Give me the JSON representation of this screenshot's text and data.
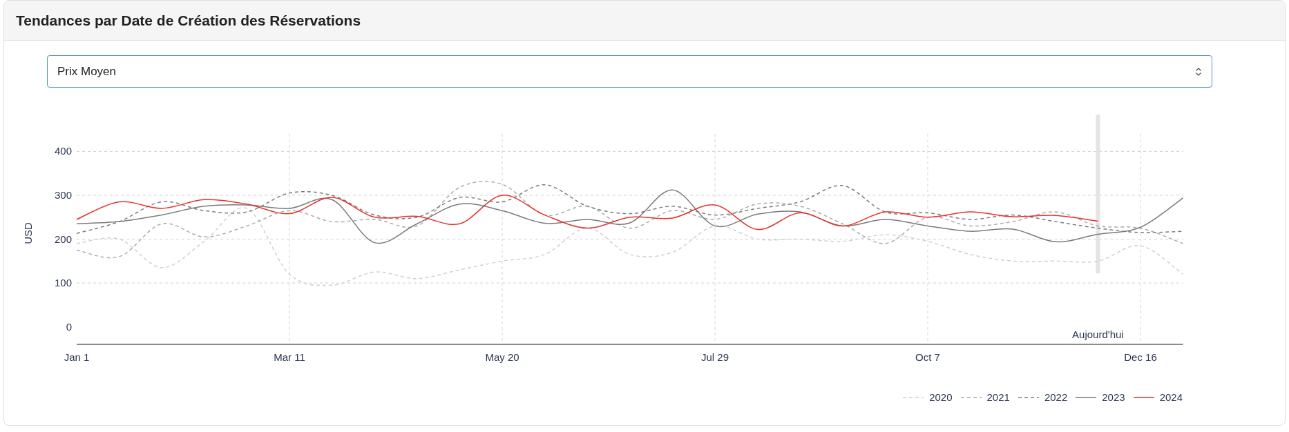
{
  "panel": {
    "title": "Tendances par Date de Création des Réservations"
  },
  "metric_select": {
    "value": "Prix Moyen"
  },
  "chart_data": {
    "type": "line",
    "ylabel": "USD",
    "grid": true,
    "ylim": [
      -40,
      440
    ],
    "categories": [
      "Jan 1",
      null,
      null,
      null,
      null,
      "Mar 11",
      null,
      null,
      null,
      null,
      "May 20",
      null,
      null,
      null,
      null,
      "Jul 29",
      null,
      null,
      null,
      null,
      "Oct 7",
      null,
      null,
      null,
      null,
      "Dec 16",
      null
    ],
    "yticks": [
      0,
      100,
      200,
      300,
      400
    ],
    "series": [
      {
        "name": "2020",
        "color": "#d0d0d0",
        "line_style": "dashed",
        "values": [
          190,
          200,
          135,
          195,
          270,
          120,
          95,
          125,
          110,
          130,
          150,
          165,
          225,
          165,
          170,
          230,
          200,
          200,
          195,
          210,
          195,
          165,
          150,
          150,
          150,
          185,
          120
        ]
      },
      {
        "name": "2021",
        "color": "#ababab",
        "line_style": "dashed",
        "values": [
          175,
          160,
          235,
          205,
          230,
          265,
          240,
          245,
          230,
          318,
          325,
          255,
          275,
          225,
          265,
          245,
          280,
          275,
          235,
          190,
          250,
          230,
          240,
          262,
          230,
          225,
          190
        ]
      },
      {
        "name": "2022",
        "color": "#7c7c7c",
        "line_style": "dashed",
        "values": [
          213,
          240,
          285,
          265,
          262,
          305,
          300,
          255,
          250,
          295,
          285,
          324,
          275,
          258,
          275,
          255,
          270,
          285,
          322,
          262,
          260,
          245,
          255,
          240,
          225,
          215,
          218
        ]
      },
      {
        "name": "2023",
        "color": "#7a7a7a",
        "line_style": "solid",
        "values": [
          235,
          240,
          255,
          275,
          278,
          270,
          290,
          192,
          235,
          280,
          265,
          236,
          245,
          237,
          312,
          230,
          257,
          262,
          230,
          245,
          230,
          218,
          223,
          194,
          211,
          227,
          294
        ]
      },
      {
        "name": "2024",
        "color": "#e8302a",
        "line_style": "solid",
        "values": [
          245,
          285,
          270,
          290,
          280,
          258,
          295,
          250,
          252,
          235,
          300,
          255,
          225,
          250,
          248,
          278,
          222,
          260,
          230,
          262,
          250,
          262,
          251,
          254,
          241,
          null,
          null
        ]
      }
    ],
    "annotations": [
      "Aujourd'hui"
    ]
  }
}
